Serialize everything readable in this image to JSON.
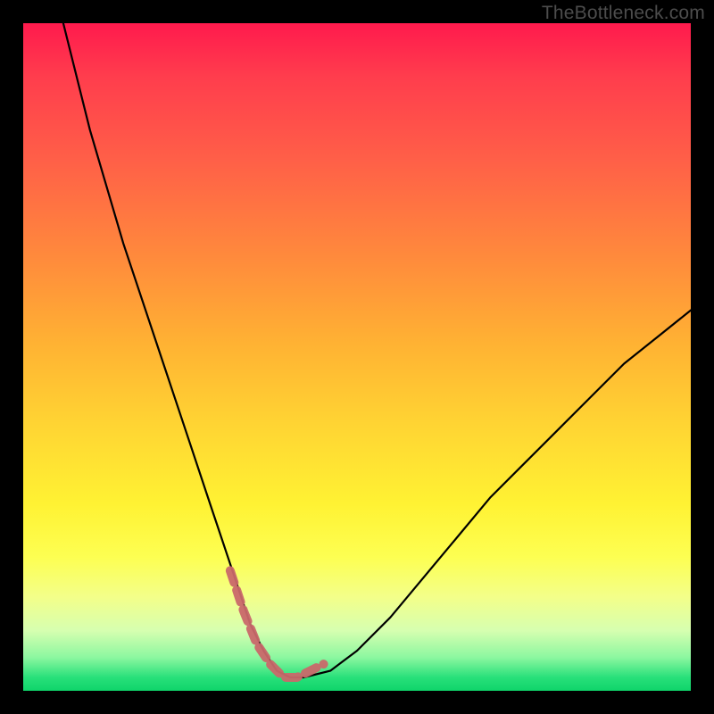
{
  "watermark": "TheBottleneck.com",
  "chart_data": {
    "type": "line",
    "title": "",
    "xlabel": "",
    "ylabel": "",
    "xlim": [
      0,
      100
    ],
    "ylim": [
      0,
      100
    ],
    "background_gradient": {
      "orientation": "vertical",
      "stops": [
        {
          "pos": 0,
          "color": "#ff1a4d"
        },
        {
          "pos": 35,
          "color": "#ff8a3c"
        },
        {
          "pos": 72,
          "color": "#fff233"
        },
        {
          "pos": 100,
          "color": "#0fd46a"
        }
      ]
    },
    "series": [
      {
        "name": "bottleneck-curve",
        "color": "#000000",
        "x": [
          6,
          10,
          15,
          20,
          25,
          28,
          30,
          32,
          34,
          36,
          38,
          40,
          42,
          46,
          50,
          55,
          60,
          65,
          70,
          75,
          80,
          85,
          90,
          95,
          100
        ],
        "y": [
          100,
          84,
          67,
          52,
          37,
          28,
          22,
          16,
          10,
          6,
          3,
          2,
          2,
          3,
          6,
          11,
          17,
          23,
          29,
          34,
          39,
          44,
          49,
          53,
          57
        ]
      },
      {
        "name": "marked-segment",
        "color": "#c9686a",
        "width": 10,
        "x": [
          31,
          33,
          35,
          37,
          39,
          41,
          43,
          45
        ],
        "y": [
          18,
          12,
          7,
          4,
          2,
          2,
          3,
          4
        ]
      }
    ]
  }
}
